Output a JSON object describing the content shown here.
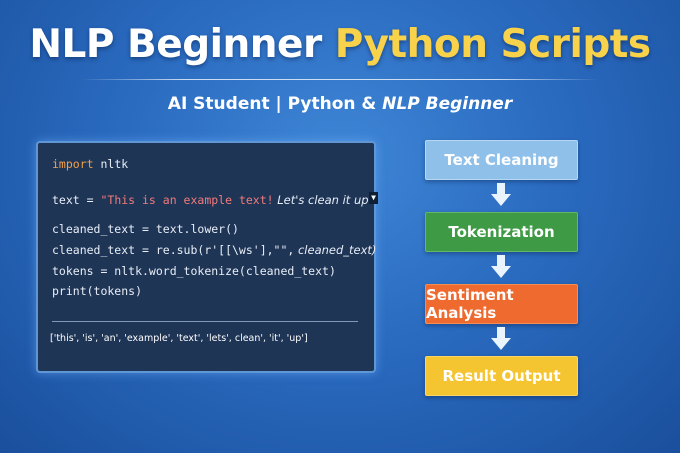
{
  "header": {
    "title_part1": "NLP Beginner",
    "title_part2": "Python Scripts",
    "subtitle_part1": "AI Student | Python &",
    "subtitle_part2": "NLP Beginner"
  },
  "code": {
    "line1_kw": "import",
    "line1_rest": " nltk",
    "line2_prefix": "text = ",
    "line2_string": "\"This is an example text!",
    "line2_italic": " Let's clean it up.",
    "line3": "cleaned_text = text.lower()",
    "line4_code": "cleaned_text = re.sub(r'[[\\ws'],\"\",",
    "line4_italic": " cleaned_text)",
    "line5": "tokens = nltk.word_tokenize(cleaned_text)",
    "line6": "print(tokens)",
    "output": "['this', 'is', 'an', 'example', 'text', 'lets', clean', 'it', 'up']"
  },
  "flow": {
    "steps": [
      "Text Cleaning",
      "Tokenization",
      "Sentiment Analysis",
      "Result Output"
    ],
    "colors": [
      "#8fc0ea",
      "#3f9a46",
      "#ee6a2f",
      "#f5c431"
    ]
  }
}
